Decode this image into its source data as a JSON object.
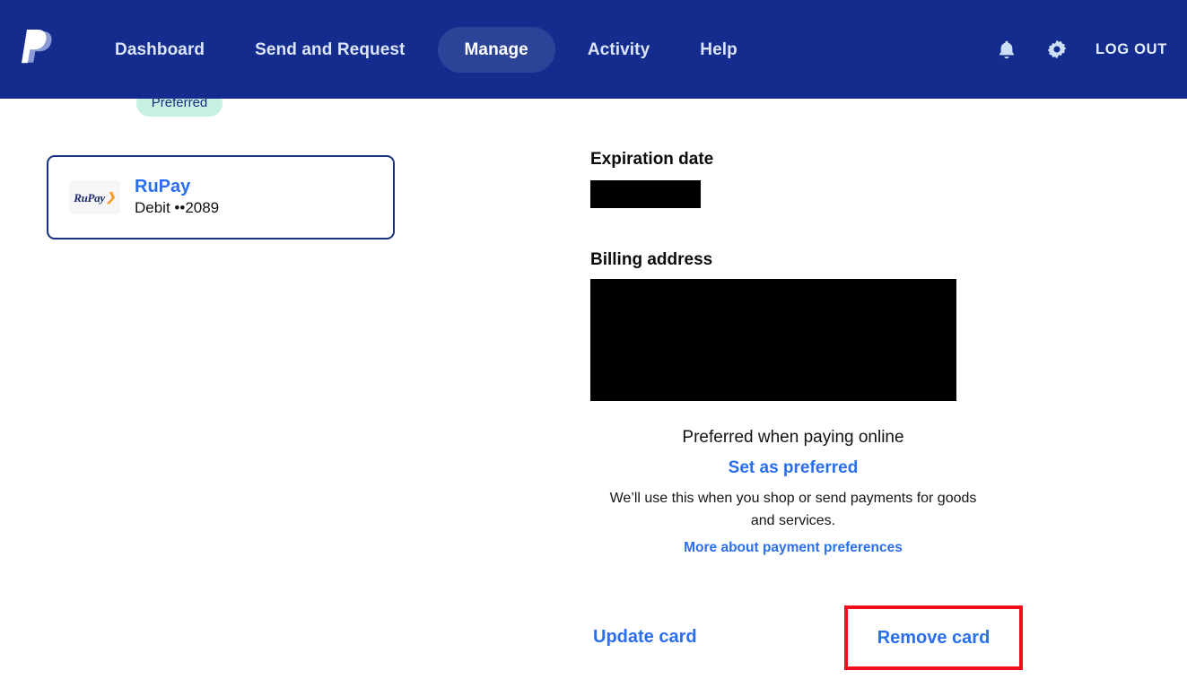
{
  "navbar": {
    "logo_name": "paypal-logo",
    "links": [
      {
        "label": "Dashboard",
        "active": false
      },
      {
        "label": "Send and Request",
        "active": false
      },
      {
        "label": "Manage",
        "active": true
      },
      {
        "label": "Activity",
        "active": false
      },
      {
        "label": "Help",
        "active": false
      }
    ],
    "bell_icon": "bell-icon",
    "gear_icon": "gear-icon",
    "logout_label": "LOG OUT",
    "background_color": "#142c8e",
    "active_pill_color": "#2b4497",
    "link_color": "#dbe5f7"
  },
  "badge": {
    "label": "Preferred",
    "background_color": "#c6f0e2",
    "text_color": "#16307d"
  },
  "card": {
    "logo_text": "RuPay",
    "logo_arrow": "❯",
    "name": "RuPay",
    "subtitle": "Debit ••2089",
    "border_color": "#17327e",
    "name_color": "#2a6ef0"
  },
  "details": {
    "expiration_label": "Expiration date",
    "expiration_value": "",
    "billing_label": "Billing address",
    "billing_value": ""
  },
  "preference": {
    "status": "Preferred when paying online",
    "action_label": "Set as preferred",
    "description": "We’ll use this when you shop or send payments for goods and services.",
    "more_link": "More about payment preferences",
    "link_color": "#2a6ef0"
  },
  "actions": {
    "update_label": "Update card",
    "remove_label": "Remove card",
    "highlight_color": "#f20d1a"
  }
}
